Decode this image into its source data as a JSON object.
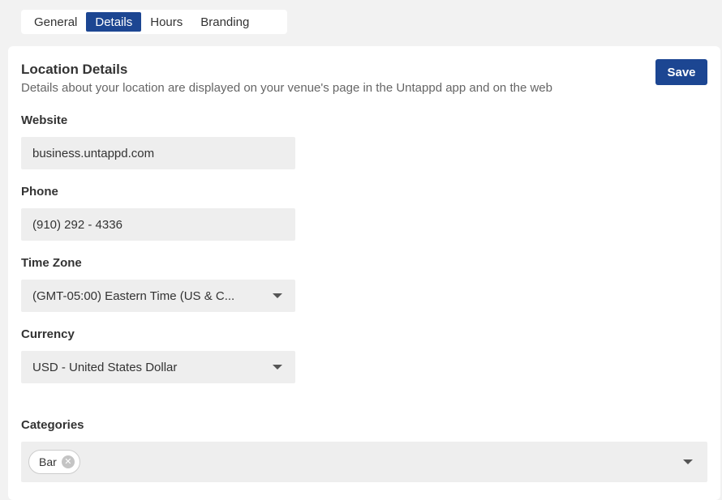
{
  "tabs": [
    {
      "label": "General",
      "active": false
    },
    {
      "label": "Details",
      "active": true
    },
    {
      "label": "Hours",
      "active": false
    },
    {
      "label": "Branding",
      "active": false
    }
  ],
  "card": {
    "title": "Location Details",
    "subtitle": "Details about your location are displayed on your venue's page in the Untappd app and on the web",
    "save_label": "Save"
  },
  "fields": {
    "website": {
      "label": "Website",
      "value": "business.untappd.com"
    },
    "phone": {
      "label": "Phone",
      "value": "(910) 292 - 4336"
    },
    "timezone": {
      "label": "Time Zone",
      "value": "(GMT-05:00) Eastern Time (US & C..."
    },
    "currency": {
      "label": "Currency",
      "value": "USD - United States Dollar"
    },
    "categories": {
      "label": "Categories",
      "chips": [
        "Bar"
      ]
    }
  },
  "icons": {
    "select_caret": "chevron-down-icon",
    "chip_remove": "close-circle-icon"
  },
  "colors": {
    "accent": "#1c4692",
    "page_bg": "#f2f2f2",
    "field_bg": "#eeeeee"
  }
}
